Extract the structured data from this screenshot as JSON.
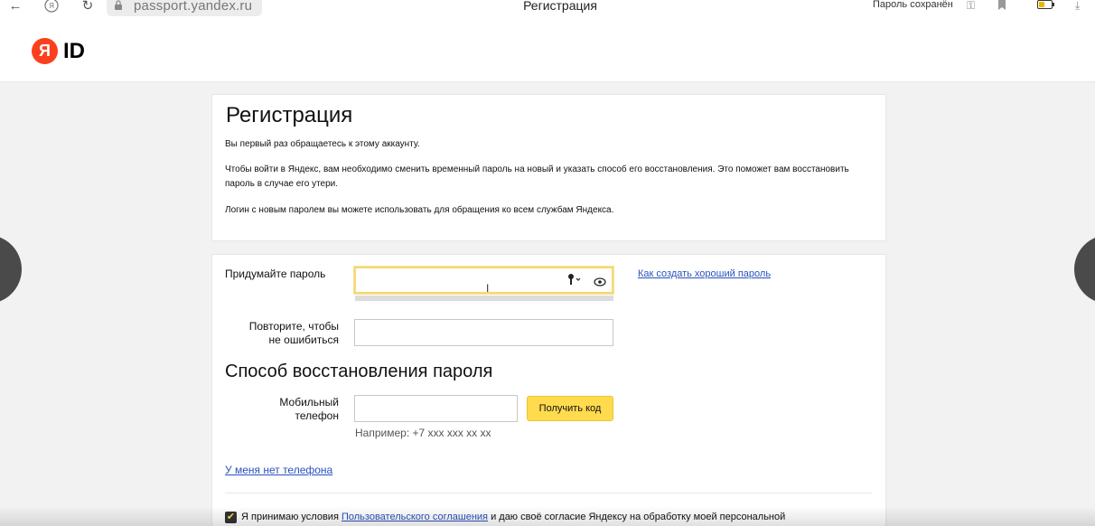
{
  "browser": {
    "url": "passport.yandex.ru",
    "tab_title": "Регистрация",
    "password_saved": "Пароль сохранён"
  },
  "header": {
    "logo_letter": "Я",
    "logo_text": "ID"
  },
  "intro": {
    "title": "Регистрация",
    "p1": "Вы первый раз обращаетесь к этому аккаунту.",
    "p2": "Чтобы войти в Яндекс, вам необходимо сменить временный пароль на новый и указать способ его восстановления. Это поможет вам восстановить пароль в случае его утери.",
    "p3": "Логин с новым паролем вы можете использовать для обращения ко всем службам Яндекса."
  },
  "form": {
    "password_label": "Придумайте пароль",
    "password_value": "",
    "password_help_link": "Как создать хороший пароль",
    "repeat_label_1": "Повторите, чтобы",
    "repeat_label_2": "не ошибиться",
    "repeat_value": ""
  },
  "recovery": {
    "title": "Способ восстановления пароля",
    "phone_label_1": "Мобильный",
    "phone_label_2": "телефон",
    "phone_value": "",
    "get_code_button": "Получить код",
    "phone_hint": "Например: +7 xxx xxx xx xx",
    "no_phone_link": "У меня нет телефона"
  },
  "terms": {
    "checked": true,
    "prefix": "Я принимаю условия ",
    "link": "Пользовательского соглашения",
    "suffix": " и даю своё согласие Яндексу на обработку моей персональной"
  },
  "colors": {
    "accent_yellow": "#ffdb4d",
    "brand_red": "#fc3f1d",
    "link_blue": "#2a52be"
  }
}
